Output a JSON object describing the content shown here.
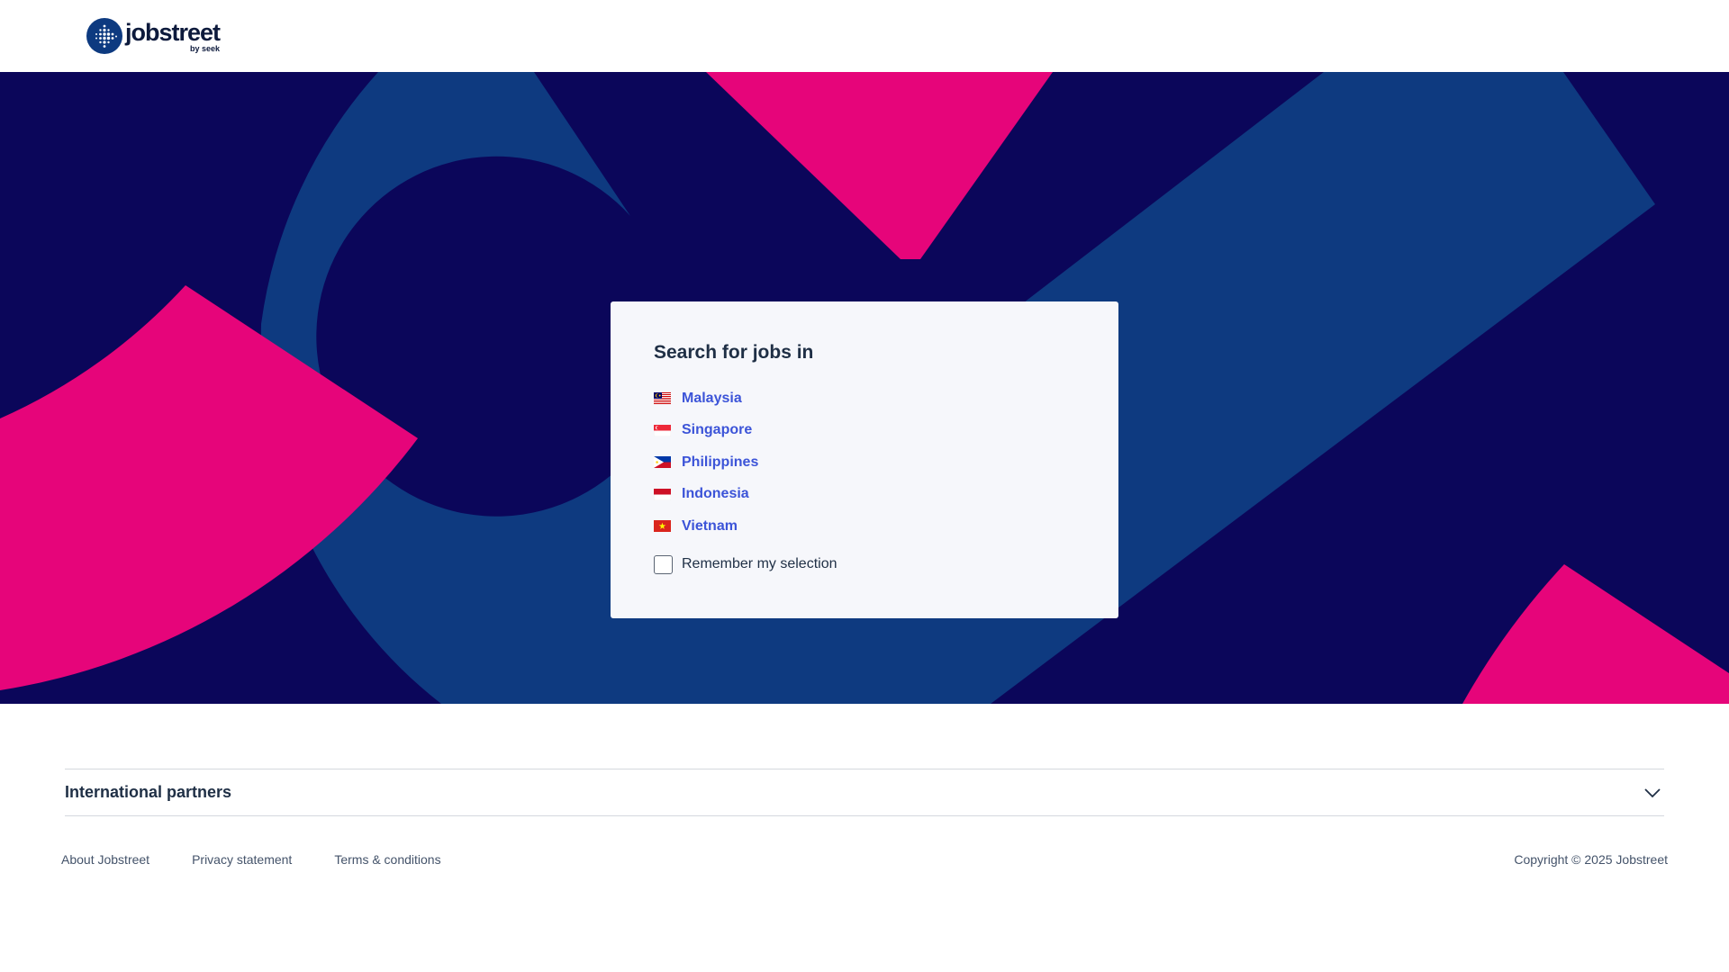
{
  "header": {
    "brand": "jobstreet",
    "brand_sub": "by seek"
  },
  "card": {
    "title": "Search for jobs in",
    "countries": [
      {
        "label": "Malaysia",
        "flag": "malaysia-flag-icon"
      },
      {
        "label": "Singapore",
        "flag": "singapore-flag-icon"
      },
      {
        "label": "Philippines",
        "flag": "philippines-flag-icon"
      },
      {
        "label": "Indonesia",
        "flag": "indonesia-flag-icon"
      },
      {
        "label": "Vietnam",
        "flag": "vietnam-flag-icon"
      }
    ],
    "remember_label": "Remember my selection",
    "remember_checked": false
  },
  "footer": {
    "partners_title": "International partners",
    "links": [
      "About Jobstreet",
      "Privacy statement",
      "Terms & conditions"
    ],
    "copyright": "Copyright © 2025 Jobstreet"
  },
  "colors": {
    "hero_bg": "#0b065a",
    "hero_blue": "#0e3a80",
    "hero_pink": "#e6057a",
    "link": "#3c54d8",
    "brand_navy": "#0d3a80"
  }
}
